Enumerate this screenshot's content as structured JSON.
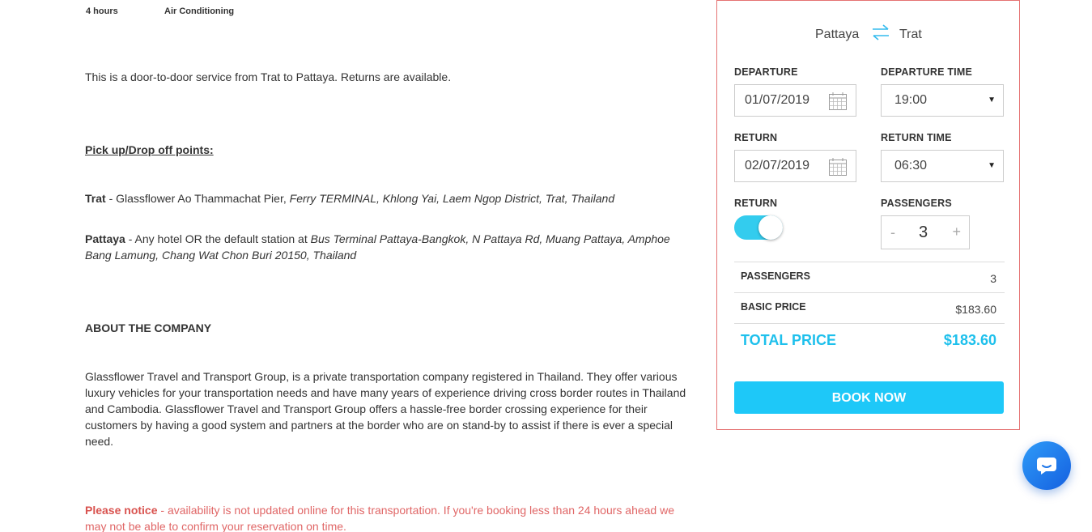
{
  "features": {
    "duration": "4 hours",
    "amenity": "Air Conditioning"
  },
  "description": {
    "intro": "This is a door-to-door service from Trat to Pattaya. Returns are available.",
    "pickup_heading": "Pick up/Drop off points:",
    "trat_name": "Trat",
    "trat_plain": " - Glassflower Ao Thammachat Pier, ",
    "trat_italic": "Ferry TERMINAL, Khlong Yai, Laem Ngop District, Trat, Thailand",
    "pattaya_name": "Pattaya",
    "pattaya_plain": " - Any hotel OR the default station at ",
    "pattaya_italic": "Bus Terminal Pattaya-Bangkok, N Pattaya Rd, Muang Pattaya, Amphoe Bang Lamung, Chang Wat Chon Buri 20150, Thailand",
    "about_heading": "ABOUT THE COMPANY",
    "about_text": "Glassflower Travel and Transport Group, is a private transportation company registered in Thailand. They offer various luxury vehicles for your transportation needs and have many years of experience driving cross border routes in Thailand and Cambodia. Glassflower Travel and Transport Group offers a hassle-free border crossing experience for their customers by having a good system and partners at the border who are on stand-by to assist if there is ever a special need.",
    "notice_label": "Please notice",
    "notice_text": " - availability is not updated online for this transportation. If you're booking less than 24 hours ahead we may not be able to confirm your reservation on time."
  },
  "booking": {
    "from": "Pattaya",
    "to": "Trat",
    "departure_label": "DEPARTURE",
    "departure_date": "01/07/2019",
    "departure_time_label": "DEPARTURE TIME",
    "departure_time": "19:00",
    "return_label": "RETURN",
    "return_date": "02/07/2019",
    "return_time_label": "RETURN TIME",
    "return_time": "06:30",
    "return_toggle_label": "RETURN",
    "return_enabled": true,
    "passengers_label": "PASSENGERS",
    "passengers": "3",
    "stepper_minus": "-",
    "stepper_plus": "+",
    "summary": {
      "passengers_label": "PASSENGERS",
      "passengers_value": "3",
      "basic_price_label": "BASIC PRICE",
      "basic_price_value": "$183.60",
      "total_label": "TOTAL PRICE",
      "total_value": "$183.60"
    },
    "book_button": "BOOK NOW"
  },
  "colors": {
    "accent": "#1ec8f8",
    "panel_border": "#e57373",
    "notice": "#d9534f",
    "toggle_on": "#33ccee"
  },
  "icons": [
    "swap-arrows-icon",
    "calendar-icon",
    "chevron-down-icon",
    "chat-icon"
  ]
}
